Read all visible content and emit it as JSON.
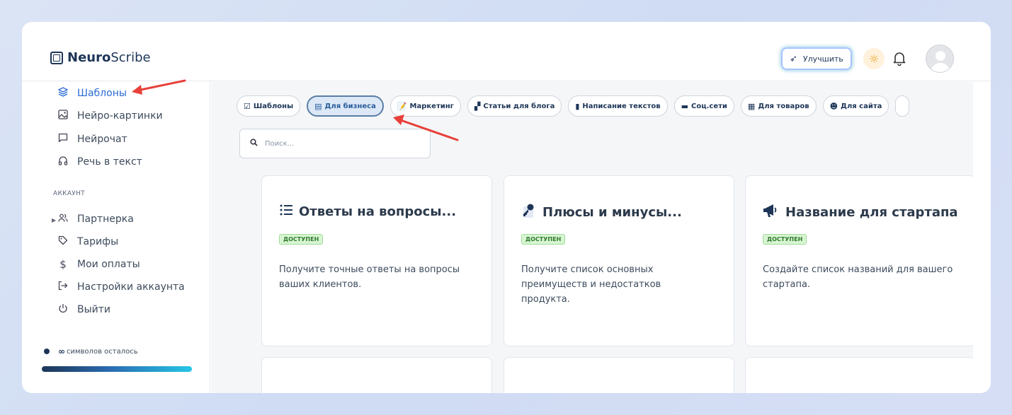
{
  "app": {
    "logo_bold": "Neuro",
    "logo_light": "Scribe"
  },
  "header": {
    "upgrade_label": "Улучшить",
    "icons": {
      "upgrade": "rocket-icon",
      "theme": "sun-icon",
      "notifications": "bell-icon",
      "avatar": "user-avatar"
    }
  },
  "sidebar": {
    "items": [
      {
        "label": "Шаблоны",
        "icon": "layers-icon",
        "active": true
      },
      {
        "label": "Нейро-картинки",
        "icon": "image-icon"
      },
      {
        "label": "Нейрочат",
        "icon": "chat-icon"
      },
      {
        "label": "Речь в текст",
        "icon": "headphones-icon"
      }
    ],
    "section_label": "АККАУНТ",
    "account_items": [
      {
        "label": "Партнерка",
        "icon": "users-icon"
      },
      {
        "label": "Тарифы",
        "icon": "tag-icon"
      },
      {
        "label": "Мои оплаты",
        "icon": "dollar-icon"
      },
      {
        "label": "Настройки аккаунта",
        "icon": "login-icon"
      },
      {
        "label": "Выйти",
        "icon": "power-icon"
      }
    ],
    "credits": {
      "symbol": "∞",
      "label": "символов осталось"
    }
  },
  "main": {
    "chips": [
      {
        "label": "Шаблоны",
        "icon": "☑"
      },
      {
        "label": "Для бизнеса",
        "icon": "▤",
        "active": true
      },
      {
        "label": "Маркетинг",
        "icon": "📝"
      },
      {
        "label": "Статьи для блога",
        "icon": "▞"
      },
      {
        "label": "Написание текстов",
        "icon": "▮"
      },
      {
        "label": "Соц.сети",
        "icon": "▬"
      },
      {
        "label": "Для товаров",
        "icon": "▦"
      },
      {
        "label": "Для сайта",
        "icon": "☻"
      }
    ],
    "search": {
      "placeholder": "Поиск..."
    },
    "cards": [
      {
        "title": "Ответы на вопросы...",
        "icon": "list-icon",
        "badge": "ДОСТУПЕН",
        "description": "Получите точные ответы на вопросы ваших клиентов."
      },
      {
        "title": "Плюсы и минусы...",
        "icon": "key-icon",
        "badge": "ДОСТУПЕН",
        "description": "Получите список основных преимуществ и недостатков продукта."
      },
      {
        "title": "Название для стартапа",
        "icon": "megaphone-icon",
        "badge": "ДОСТУПЕН",
        "description": "Создайте список названий для вашего стартапа."
      }
    ]
  },
  "colors": {
    "accent": "#2a6bd6",
    "brand": "#1d3557",
    "badge_bg": "#d7f5d3",
    "arrow": "#e8403a"
  }
}
